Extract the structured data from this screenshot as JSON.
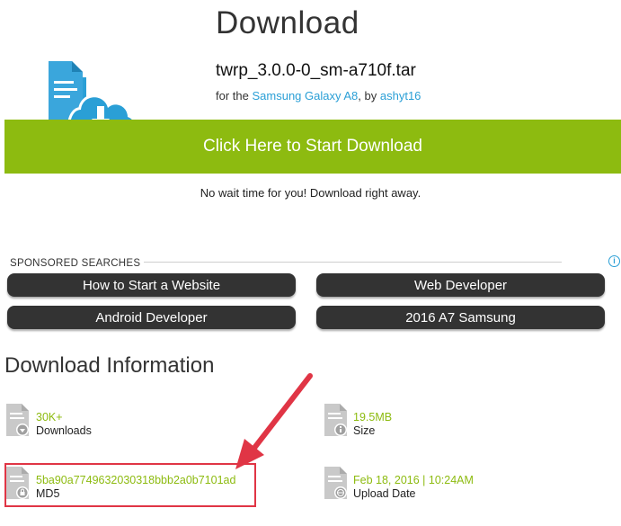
{
  "page": {
    "title": "Download",
    "filename": "twrp_3.0.0-0_sm-a710f.tar",
    "for_prefix": "for the",
    "device": "Samsung Galaxy A8",
    "by_text": ", by",
    "author": "ashyt16",
    "download_button": "Click Here to Start Download",
    "no_wait": "No wait time for you! Download right away."
  },
  "sponsored": {
    "label": "SPONSORED SEARCHES",
    "info_icon": "i",
    "items": [
      "How to Start a Website",
      "Web Developer",
      "Android Developer",
      "2016 A7 Samsung"
    ]
  },
  "info": {
    "heading": "Download Information",
    "downloads": {
      "value": "30K+",
      "label": "Downloads",
      "icon": "download-file-icon"
    },
    "size": {
      "value": "19.5MB",
      "label": "Size",
      "icon": "info-file-icon"
    },
    "md5": {
      "value": "5ba90a7749632030318bbb2a0b7101ad",
      "label": "MD5",
      "icon": "lock-file-icon"
    },
    "upload": {
      "value": "Feb 18, 2016 | 10:24AM",
      "label": "Upload Date",
      "icon": "globe-file-icon"
    }
  },
  "colors": {
    "accent_green": "#8dbb10",
    "link_blue": "#2a9fd6",
    "annotation_red": "#e03545",
    "pill_dark": "#333333"
  }
}
